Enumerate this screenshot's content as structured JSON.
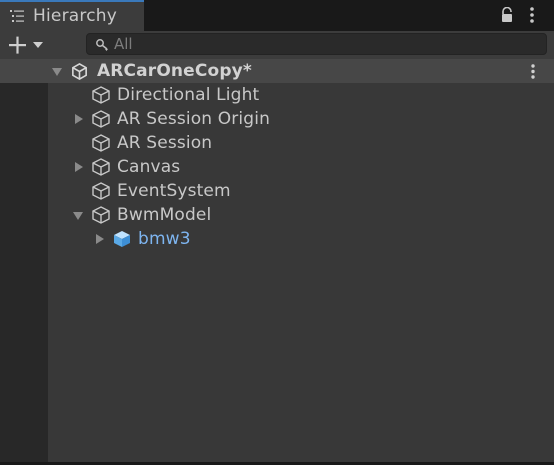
{
  "tab": {
    "title": "Hierarchy",
    "icon": "hierarchy-list-icon"
  },
  "toolbar": {
    "create_icon": "plus-icon",
    "search_placeholder": "All",
    "search_value": ""
  },
  "scene": {
    "name": "ARCarOneCopy*",
    "icon": "unity-logo-icon"
  },
  "items": [
    {
      "label": "Directional Light",
      "has_children": false,
      "expanded": false,
      "prefab": false
    },
    {
      "label": "AR Session Origin",
      "has_children": true,
      "expanded": false,
      "prefab": false
    },
    {
      "label": "AR Session",
      "has_children": false,
      "expanded": false,
      "prefab": false
    },
    {
      "label": "Canvas",
      "has_children": true,
      "expanded": false,
      "prefab": false
    },
    {
      "label": "EventSystem",
      "has_children": false,
      "expanded": false,
      "prefab": false
    },
    {
      "label": "BwmModel",
      "has_children": true,
      "expanded": true,
      "prefab": false
    },
    {
      "label": "bmw3",
      "has_children": true,
      "expanded": false,
      "prefab": true
    }
  ],
  "colors": {
    "accent": "#3a79bb",
    "prefab_text": "#7eb5f0",
    "panel_bg": "#383838"
  }
}
